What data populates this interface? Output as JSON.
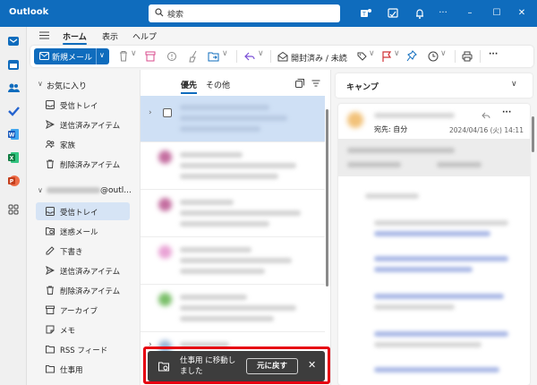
{
  "titlebar": {
    "app_title": "Outlook",
    "search_placeholder": "検索",
    "accent": "#0f6cbd"
  },
  "rail": {
    "items": [
      "mail-icon",
      "calendar-icon",
      "people-icon",
      "todo-icon",
      "word-icon",
      "excel-icon",
      "powerpoint-icon",
      "apps-icon"
    ]
  },
  "tabs": [
    "ホーム",
    "表示",
    "ヘルプ"
  ],
  "ribbon": {
    "new_mail": "新規メール",
    "mark_read": "開封済み / 未読"
  },
  "folders": {
    "favorites_title": "お気に入り",
    "favorites": [
      "受信トレイ",
      "送信済みアイテム",
      "家族",
      "削除済みアイテム"
    ],
    "account_suffix": "@outl...",
    "account_folders": [
      "受信トレイ",
      "迷惑メール",
      "下書き",
      "送信済みアイテム",
      "削除済みアイテム",
      "アーカイブ",
      "メモ",
      "RSS フィード",
      "仕事用"
    ]
  },
  "message_list": {
    "tab_focused": "優先",
    "tab_other": "その他"
  },
  "reading_pane": {
    "header": "キャンプ",
    "to_line": "宛先: 自分",
    "date": "2024/04/16 (火) 14:11"
  },
  "toast": {
    "message": "仕事用 に移動しました",
    "undo": "元に戻す"
  }
}
